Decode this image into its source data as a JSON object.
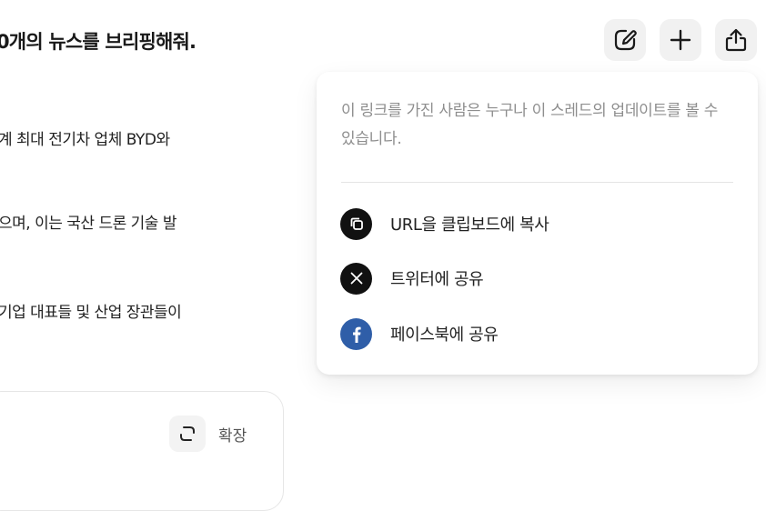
{
  "thread": {
    "title": "0개의 뉴스를 브리핑해줘.",
    "paragraphs": [
      "계 최대 전기차 업체 BYD와",
      "으며, 이는 국산 드론 기술 발",
      "기업 대표들 및 산업 장관들이"
    ],
    "expand_label": "확장"
  },
  "toolbar": {
    "icons": [
      "edit-icon",
      "plus-icon",
      "share-icon"
    ]
  },
  "share_menu": {
    "description": "이 링크를 가진 사람은 누구나 이 스레드의 업데이트를 볼 수 있습니다.",
    "items": [
      {
        "label": "URL을 클립보드에 복사",
        "icon": "copy-icon"
      },
      {
        "label": "트위터에 공유",
        "icon": "x-twitter-icon"
      },
      {
        "label": "페이스북에 공유",
        "icon": "facebook-icon"
      }
    ]
  },
  "colors": {
    "menu_text": "#222222",
    "muted_text": "#8e8e8e",
    "facebook_blue": "#2f5ea8",
    "button_bg": "#f1f1f1"
  }
}
